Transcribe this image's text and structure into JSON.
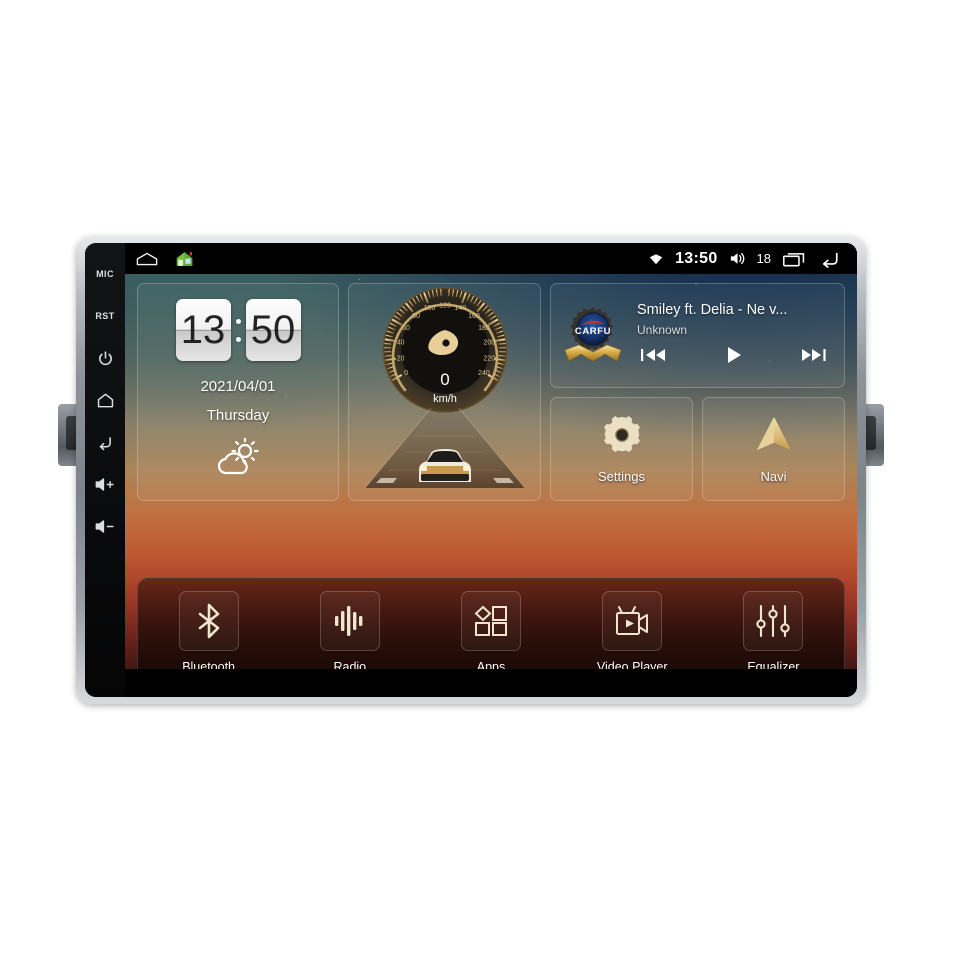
{
  "device": {
    "hardware_keys": [
      {
        "name": "mic-key",
        "label": "MIC",
        "icon": "text"
      },
      {
        "name": "reset-key",
        "label": "RST",
        "icon": "text"
      },
      {
        "name": "power-key",
        "label": "",
        "icon": "power-icon"
      },
      {
        "name": "home-key",
        "label": "",
        "icon": "home-icon"
      },
      {
        "name": "back-key",
        "label": "",
        "icon": "back-icon"
      },
      {
        "name": "volume-up-key",
        "label": "",
        "icon": "volume-up-icon"
      },
      {
        "name": "volume-down-key",
        "label": "",
        "icon": "volume-down-icon"
      }
    ]
  },
  "statusbar": {
    "nav_home_icon": "home-outline-icon",
    "launcher_icon": "house-color-icon",
    "signal_icon": "wifi-diamond-icon",
    "time": "13:50",
    "volume_icon": "speaker-icon",
    "volume_level": "18",
    "recents_icon": "recents-icon",
    "back_icon": "back-arrow-icon"
  },
  "clock_widget": {
    "hours": "13",
    "minutes": "50",
    "date": "2021/04/01",
    "weekday": "Thursday",
    "weather_icon": "partly-cloudy-icon"
  },
  "speedometer_widget": {
    "value": "0",
    "unit": "km/h",
    "ticks": [
      "0",
      "20",
      "40",
      "60",
      "80",
      "100",
      "120",
      "140",
      "160",
      "180",
      "200",
      "220",
      "240"
    ]
  },
  "music_widget": {
    "logo_text": "CARFU",
    "track_title": "Smiley ft. Delia - Ne v...",
    "artist": "Unknown",
    "prev_label": "previous-track",
    "play_label": "play",
    "next_label": "next-track"
  },
  "tiles": [
    {
      "name": "settings",
      "label": "Settings",
      "icon": "gear-icon"
    },
    {
      "name": "navi",
      "label": "Navi",
      "icon": "navigation-arrow-icon"
    }
  ],
  "dock": [
    {
      "name": "bluetooth",
      "label": "Bluetooth",
      "icon": "bluetooth-icon"
    },
    {
      "name": "radio",
      "label": "Radio",
      "icon": "radio-waveform-icon"
    },
    {
      "name": "apps",
      "label": "Apps",
      "icon": "apps-grid-icon"
    },
    {
      "name": "video-player",
      "label": "Video Player",
      "icon": "video-camera-icon"
    },
    {
      "name": "equalizer",
      "label": "Equalizer",
      "icon": "equalizer-sliders-icon"
    }
  ],
  "colors": {
    "gold": "#e8cf9a",
    "accent_blue": "#1e3f7a",
    "status_bg": "#000000"
  }
}
